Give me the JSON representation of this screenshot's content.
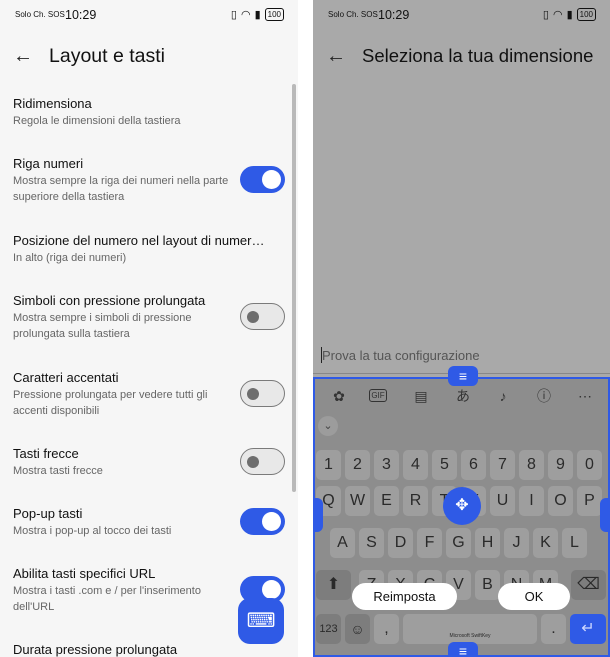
{
  "left": {
    "status": {
      "carrier": "Solo Ch. SOS",
      "time": "10:29",
      "battery": "100"
    },
    "title": "Layout e tasti",
    "items": [
      {
        "title": "Ridimensiona",
        "subtitle": "Regola le dimensioni della tastiera"
      },
      {
        "title": "Riga numeri",
        "subtitle": "Mostra sempre la riga dei numeri nella parte superiore della tastiera",
        "toggle": "on"
      },
      {
        "title": "Posizione del numero nel layout di numer…",
        "subtitle": "In alto (riga dei numeri)"
      },
      {
        "title": "Simboli con pressione prolungata",
        "subtitle": "Mostra sempre i simboli di pressione prolungata sulla tastiera",
        "toggle": "off"
      },
      {
        "title": "Caratteri accentati",
        "subtitle": "Pressione prolungata per vedere tutti gli accenti disponibili",
        "toggle": "off"
      },
      {
        "title": "Tasti frecce",
        "subtitle": "Mostra tasti frecce",
        "toggle": "off"
      },
      {
        "title": "Pop-up tasti",
        "subtitle": "Mostra i pop-up al tocco dei tasti",
        "toggle": "on"
      },
      {
        "title": "Abilita tasti specifici URL",
        "subtitle": "Mostra i tasti .com e / per l'inserimento dell'URL",
        "toggle": "on"
      },
      {
        "title": "Durata pressione prolungata",
        "subtitle": ""
      }
    ],
    "fab_icon": "keyboard-icon"
  },
  "right": {
    "status": {
      "carrier": "Solo Ch. SOS",
      "time": "10:29",
      "battery": "100"
    },
    "title": "Seleziona la tua dimensione",
    "input_placeholder": "Prova la tua configurazione",
    "toolbar_icons": [
      "copilot-icon",
      "gif-icon",
      "clipboard-icon",
      "translate-icon",
      "mic-icon",
      "info-icon",
      "more-icon"
    ],
    "gif_label": "GIF",
    "number_row": [
      "1",
      "2",
      "3",
      "4",
      "5",
      "6",
      "7",
      "8",
      "9",
      "0"
    ],
    "row1": [
      "Q",
      "W",
      "E",
      "R",
      "T",
      "Y",
      "U",
      "I",
      "O",
      "P"
    ],
    "row2": [
      "A",
      "S",
      "D",
      "F",
      "G",
      "H",
      "J",
      "K",
      "L"
    ],
    "row3": [
      "Z",
      "X",
      "C",
      "V",
      "B",
      "N",
      "M"
    ],
    "key_123": "123",
    "key_comma": ",",
    "key_period": ".",
    "space_brand": "Microsoft SwiftKey",
    "reset_label": "Reimposta",
    "ok_label": "OK"
  },
  "colors": {
    "accent": "#2f5ae6",
    "toggle_off": "#e8e8e8",
    "overlay": "#a9a9a9"
  }
}
